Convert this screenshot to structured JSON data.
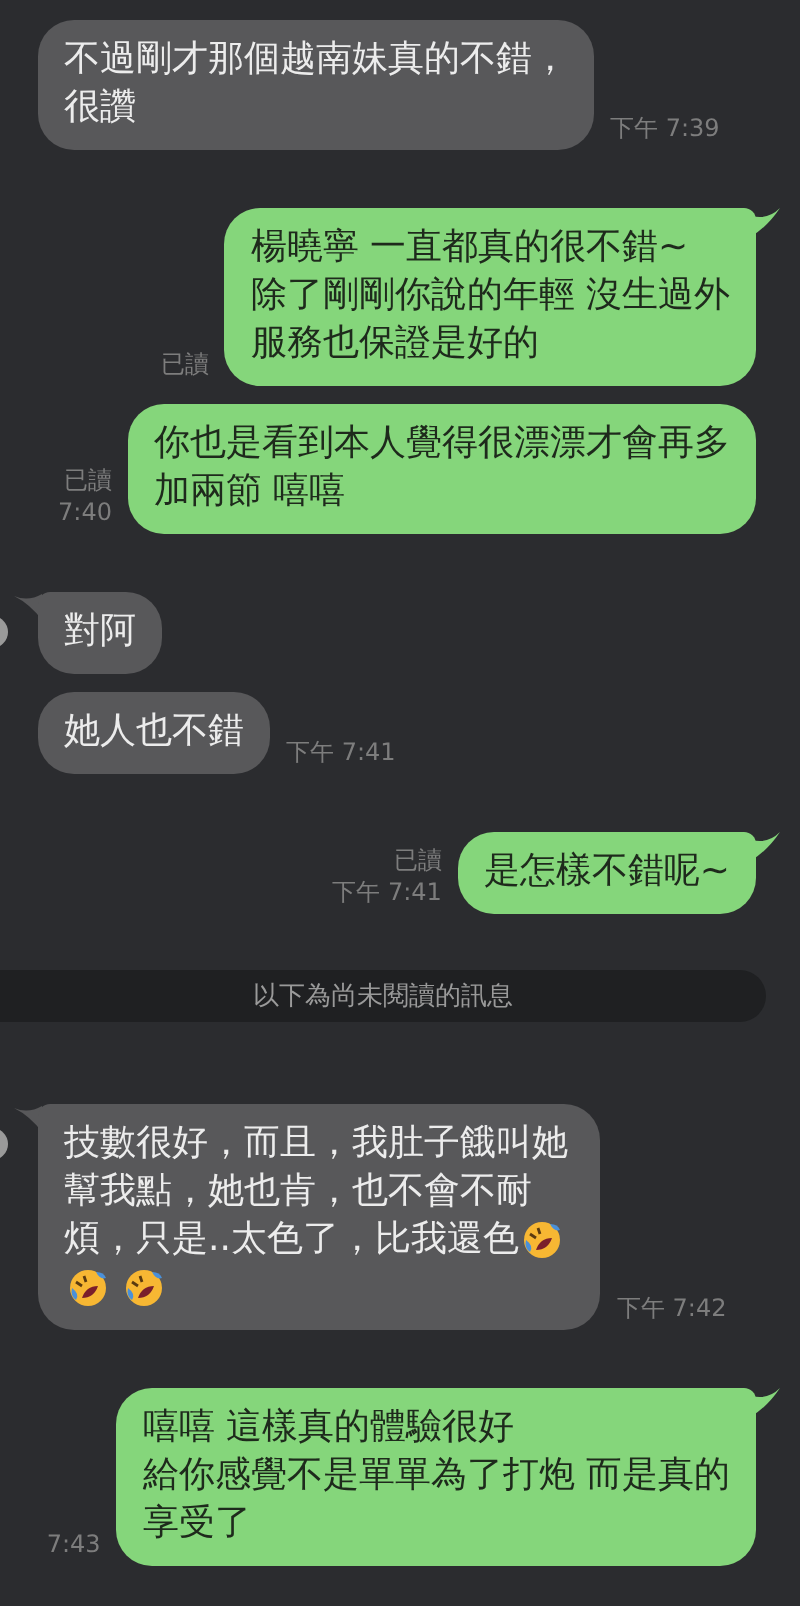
{
  "messages": [
    {
      "kind": "incoming",
      "tail": false,
      "lines": [
        {
          "text": "不過剛才那個越南妹真的不錯，"
        },
        {
          "text": "很讚"
        }
      ],
      "time": "下午 7:39"
    },
    {
      "kind": "outgoing",
      "tail": true,
      "lines": [
        {
          "text": "楊曉寧 一直都真的很不錯~"
        },
        {
          "text": "除了剛剛你說的年輕 沒生過外"
        },
        {
          "text": "服務也保證是好的"
        }
      ],
      "read": "已讀"
    },
    {
      "kind": "outgoing",
      "tail": false,
      "lines": [
        {
          "text": "你也是看到本人覺得很漂漂才會再多"
        },
        {
          "text": "加兩節 嘻嘻"
        }
      ],
      "read": "已讀",
      "time": "7:40"
    },
    {
      "kind": "incoming",
      "tail": true,
      "lines": [
        {
          "text": "對阿"
        }
      ]
    },
    {
      "kind": "incoming",
      "tail": false,
      "lines": [
        {
          "text": "她人也不錯"
        }
      ],
      "time": "下午 7:41"
    },
    {
      "kind": "outgoing",
      "tail": true,
      "lines": [
        {
          "text": "是怎樣不錯呢~"
        }
      ],
      "read": "已讀",
      "time": "下午 7:41"
    },
    {
      "kind": "divider",
      "text": "以下為尚未閱讀的訊息"
    },
    {
      "kind": "incoming",
      "tail": true,
      "lines": [
        {
          "text": "技數很好，而且，我肚子餓叫她"
        },
        {
          "text": "幫我點，她也肯，也不會不耐"
        },
        {
          "text": "煩，只是..太色了，比我還色",
          "emojis": [
            {
              "kind": "rolling-laughing"
            }
          ]
        },
        {
          "emojis": [
            {
              "kind": "rolling-laughing"
            },
            {
              "kind": "rolling-laughing"
            }
          ]
        }
      ],
      "time": "下午 7:42"
    },
    {
      "kind": "outgoing",
      "tail": true,
      "lines": [
        {
          "text": "嘻嘻 這樣真的體驗很好"
        },
        {
          "text": "給你感覺不是單單為了打炮 而是真的"
        },
        {
          "text": "享受了"
        }
      ],
      "time": "7:43"
    }
  ]
}
